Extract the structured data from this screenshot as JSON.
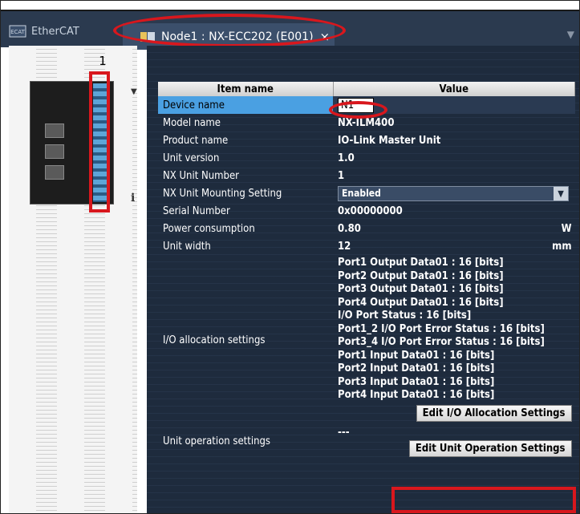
{
  "tabs": [
    {
      "label": "EtherCAT",
      "icon": "ethercat-icon"
    },
    {
      "label": "Node1 : NX-ECC202 (E001)",
      "icon": "node-icon",
      "close": "×"
    }
  ],
  "left_panel": {
    "unit_number": "1",
    "info": "i"
  },
  "table": {
    "headers": [
      "Item name",
      "Value"
    ],
    "rows": [
      {
        "name": "Device name",
        "value": "N1"
      },
      {
        "name": "Model name",
        "value": "NX-ILM400"
      },
      {
        "name": "Product name",
        "value": "IO-Link Master Unit"
      },
      {
        "name": "Unit version",
        "value": "1.0"
      },
      {
        "name": "NX Unit Number",
        "value": "1"
      },
      {
        "name": "NX Unit Mounting Setting",
        "value": "Enabled"
      },
      {
        "name": "Serial Number",
        "value": "0x00000000"
      },
      {
        "name": "Power consumption",
        "value": "0.80",
        "unit": "W"
      },
      {
        "name": "Unit width",
        "value": "12",
        "unit": "mm"
      }
    ],
    "io_allocation": {
      "name": "I/O allocation settings",
      "items": [
        "Port1 Output Data01 : 16 [bits]",
        "Port2 Output Data01 : 16 [bits]",
        "Port3 Output Data01 : 16 [bits]",
        "Port4 Output Data01 : 16 [bits]",
        "I/O Port Status : 16 [bits]",
        "Port1_2 I/O Port Error Status : 16 [bits]",
        "Port3_4 I/O Port Error Status : 16 [bits]",
        "Port1 Input Data01 : 16 [bits]",
        "Port2 Input Data01 : 16 [bits]",
        "Port3 Input Data01 : 16 [bits]",
        "Port4 Input Data01 : 16 [bits]"
      ],
      "button": "Edit I/O Allocation Settings"
    },
    "unit_operation": {
      "name": "Unit operation settings",
      "value": "---",
      "button": "Edit Unit Operation Settings"
    }
  },
  "colors": {
    "highlight": "#d8171d",
    "selected_row": "#4aa0e2",
    "panel_bg": "#1e2b3d"
  }
}
